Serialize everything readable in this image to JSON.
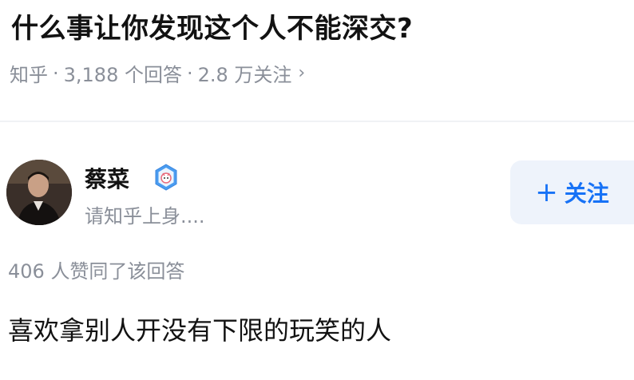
{
  "question": {
    "title": "什么事让你发现这个人不能深交?",
    "source": "知乎",
    "answers_count": "3,188 个回答",
    "followers": "2.8 万关注",
    "separator": "·",
    "chevron": "›"
  },
  "author": {
    "name": "蔡菜",
    "bio": "请知乎上身....",
    "avatar_icon": "avatar-photo",
    "badge_icon": "verified-badge-icon"
  },
  "follow_button": {
    "plus": "+",
    "label": "关注"
  },
  "answer": {
    "votes": "406 人赞同了该回答",
    "content": "喜欢拿别人开没有下限的玩笑的人"
  },
  "colors": {
    "accent": "#1772f6",
    "muted": "#8a8f99",
    "button_bg": "#eef3fb"
  }
}
